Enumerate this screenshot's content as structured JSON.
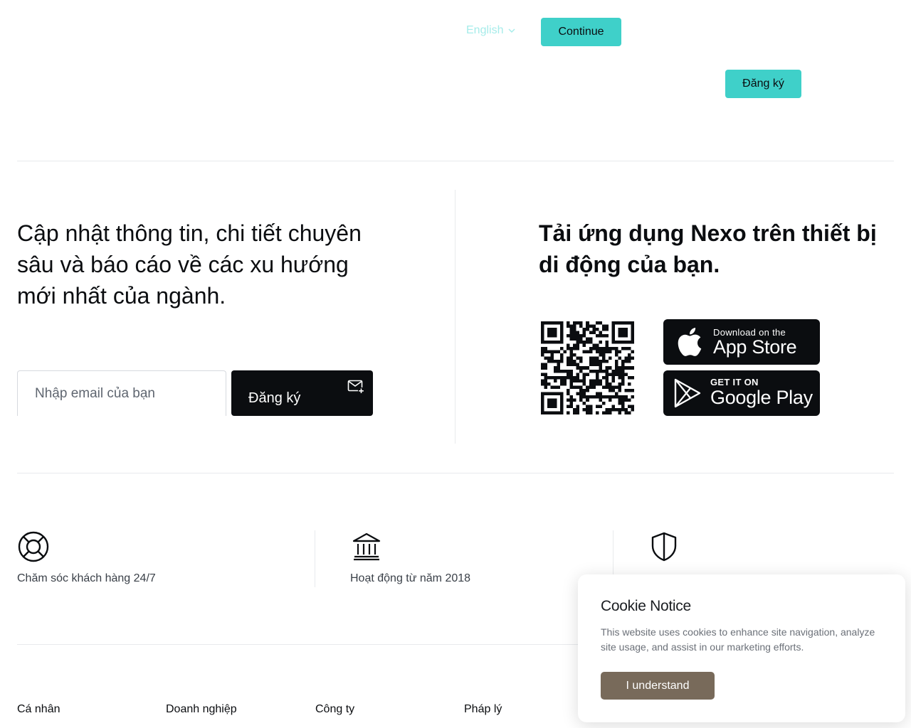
{
  "header": {
    "language_label": "English",
    "continue_label": "Continue",
    "signup_label": "Đăng ký"
  },
  "newsletter": {
    "title": "Cập nhật thông tin, chi tiết chuyên sâu và báo cáo về các xu hướng mới nhất của ngành.",
    "email_placeholder": "Nhập email của bạn",
    "subscribe_label": "Đăng ký"
  },
  "app_download": {
    "title": "Tải ứng dụng Nexo trên thiết bị di động của bạn.",
    "app_store_small": "Download on the",
    "app_store_big": "App Store",
    "google_play_small": "GET IT ON",
    "google_play_big": "Google Play"
  },
  "features": [
    {
      "icon": "lifebuoy-icon",
      "text": "Chăm sóc khách hàng 24/7"
    },
    {
      "icon": "bank-icon",
      "text": "Hoạt động từ năm 2018"
    },
    {
      "icon": "shield-icon",
      "text": ""
    }
  ],
  "footer_columns": [
    "Cá nhân",
    "Doanh nghiệp",
    "Công ty",
    "Pháp lý"
  ],
  "cookie_notice": {
    "title": "Cookie Notice",
    "body": "This website uses cookies to enhance site navigation, analyze site usage, and assist in our marketing efforts.",
    "button_label": "I understand"
  },
  "colors": {
    "accent": "#3fd0c9",
    "dark": "#0b0d10",
    "cookie_button": "#786a5a"
  }
}
